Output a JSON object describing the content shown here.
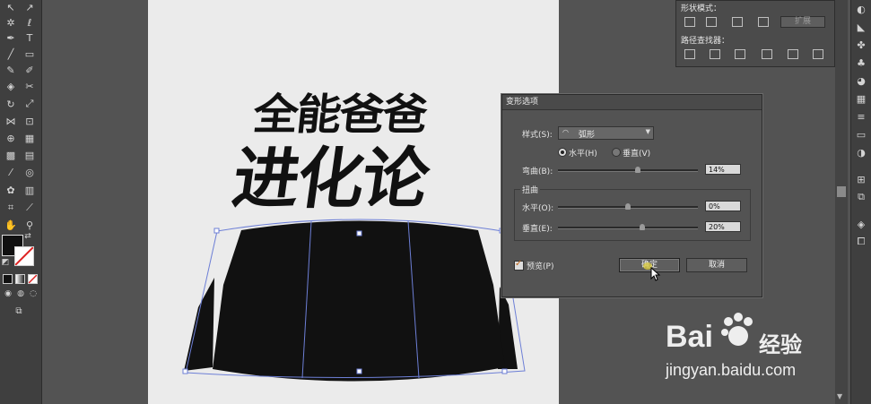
{
  "panel": {
    "shape_modes_label": "形状模式：",
    "expand_label": "扩展",
    "pathfinder_label": "路径查找器："
  },
  "artwork": {
    "title_line1": "全能爸爸",
    "title_line2": "进化论"
  },
  "dialog": {
    "title": "变形选项",
    "style_label": "样式(S):",
    "style_value": "弧形",
    "horizontal_label": "水平(H)",
    "vertical_label": "垂直(V)",
    "bend_label": "弯曲(B):",
    "bend_value": "14%",
    "bend_level": 0.57,
    "distortion_label": "扭曲",
    "dist_h_label": "水平(O):",
    "dist_h_value": "0%",
    "dist_h_level": 0.5,
    "dist_v_label": "垂直(E):",
    "dist_v_value": "20%",
    "dist_v_level": 0.6,
    "preview_label": "预览(P)",
    "ok_label": "确定",
    "cancel_label": "取消"
  },
  "watermark": {
    "brand": "Bai",
    "brand_cn": "经验",
    "url": "jingyan.baidu.com"
  },
  "colors": {
    "accent": "#cf9b3a",
    "selection": "#6d7fd6",
    "fill_black": "#111111"
  }
}
